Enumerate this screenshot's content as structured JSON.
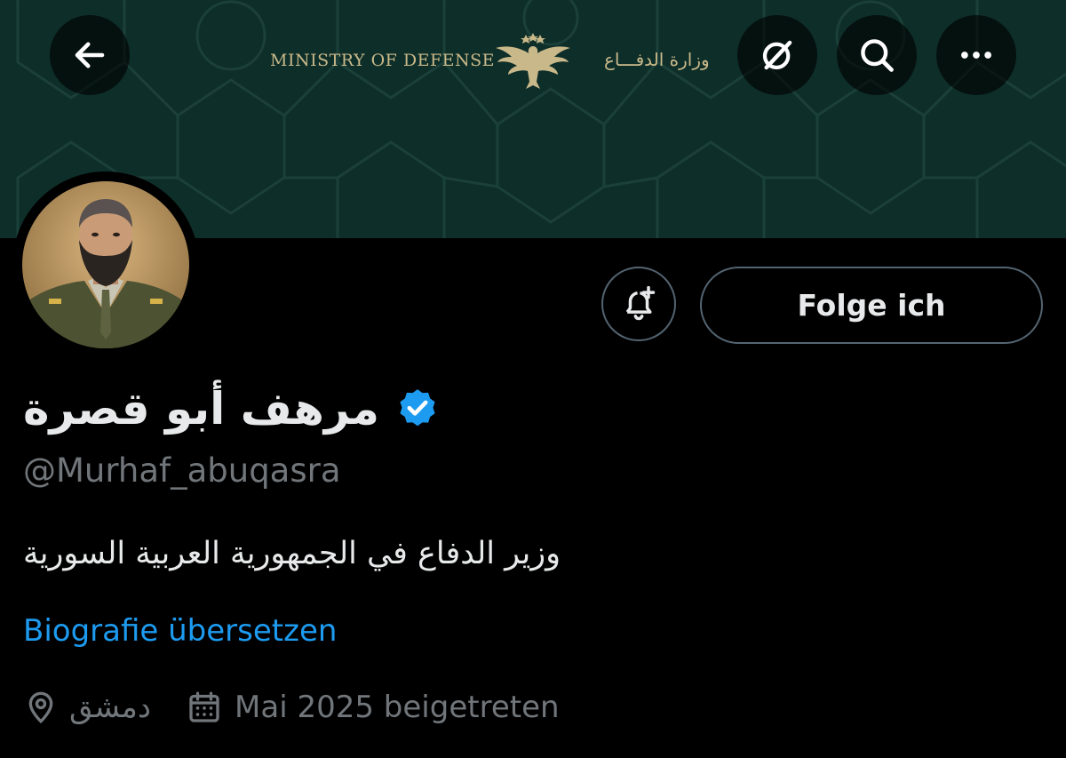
{
  "banner": {
    "title_en": "MINISTRY OF DEFENSE",
    "title_ar": "وزارة الدفـــاع",
    "emblem_icon": "eagle-emblem-icon",
    "background_color": "#0e2e29",
    "accent_color": "#c9b98a"
  },
  "header_buttons": {
    "back_icon": "arrow-left-icon",
    "grok_icon": "grok-icon",
    "search_icon": "search-icon",
    "more_icon": "more-dots-icon"
  },
  "profile": {
    "display_name": "مرهف أبو قصرة",
    "verified": true,
    "verified_color": "#1d9bf0",
    "handle": "@Murhaf_abuqasra",
    "bio": "وزير الدفاع في الجمهورية العربية السورية",
    "translate_label": "Biografie übersetzen",
    "location": "دمشق",
    "joined": "Mai 2025 beigetreten"
  },
  "actions": {
    "notify_icon": "bell-plus-icon",
    "follow_label": "Folge ich"
  }
}
